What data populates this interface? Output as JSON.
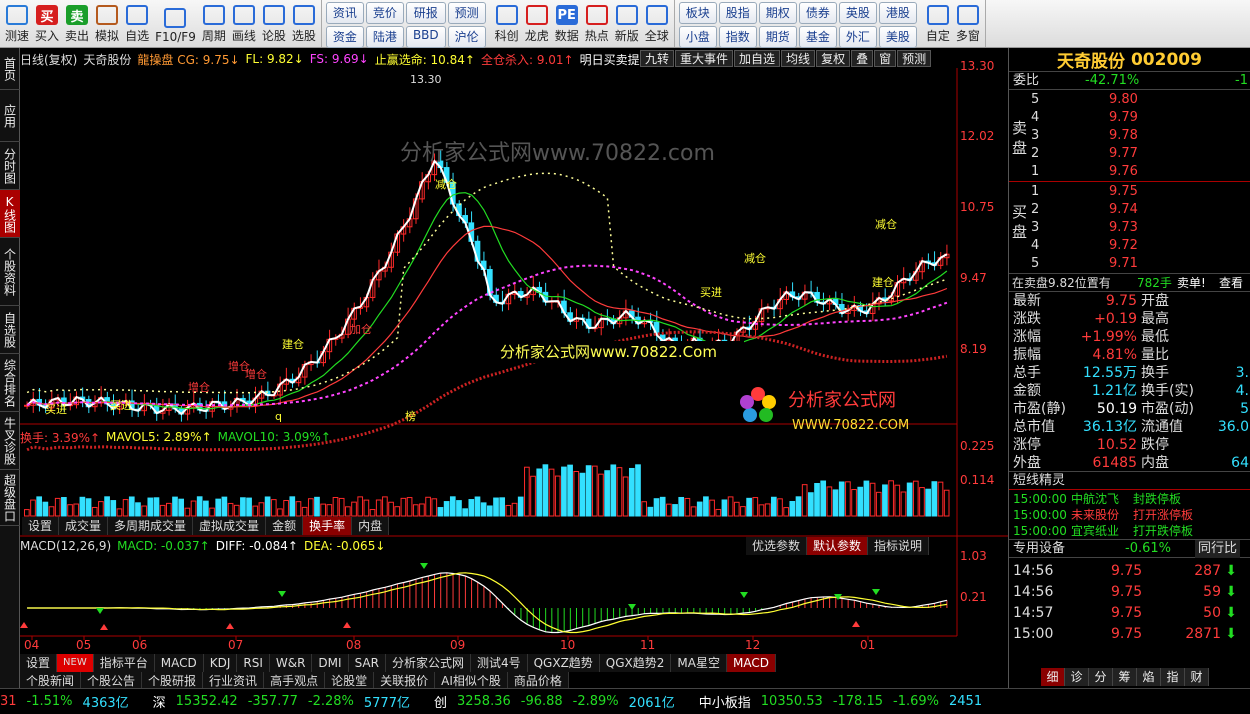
{
  "toolbar": {
    "buttons": [
      {
        "label": "测速",
        "icon": "speed-icon",
        "color": "#2a7bd8"
      },
      {
        "label": "买入",
        "icon": "buy-icon",
        "color": "#d61f1f",
        "glyph": "买"
      },
      {
        "label": "卖出",
        "icon": "sell-icon",
        "color": "#1a9e2a",
        "glyph": "卖"
      },
      {
        "label": "模拟",
        "icon": "hammer-icon",
        "color": "#b55a1e"
      },
      {
        "label": "自选",
        "icon": "star-folder-icon",
        "color": "#2a6bd8"
      },
      {
        "label": "F10/F9",
        "icon": "f10-icon",
        "color": "#2a6bd8"
      },
      {
        "label": "周期",
        "icon": "clock-icon",
        "color": "#2a6bd8"
      },
      {
        "label": "画线",
        "icon": "pen-icon",
        "color": "#2a6bd8"
      },
      {
        "label": "论股",
        "icon": "forum-icon",
        "color": "#2a6bd8"
      },
      {
        "label": "选股",
        "icon": "magnify-icon",
        "color": "#2a6bd8"
      }
    ],
    "group1": [
      "资讯",
      "资金",
      "竞价",
      "陆港",
      "研报",
      "BBD",
      "预测",
      "沪伦"
    ],
    "buttons2": [
      {
        "label": "科创",
        "icon": "tech-icon",
        "color": "#2a6bd8"
      },
      {
        "label": "龙虎",
        "icon": "dragon-icon",
        "color": "#d61f1f"
      },
      {
        "label": "数据",
        "icon": "pe-icon",
        "color": "#2a6bd8",
        "glyph": "PE"
      },
      {
        "label": "热点",
        "icon": "hot-icon",
        "color": "#d61f1f"
      },
      {
        "label": "新版",
        "icon": "new-icon",
        "color": "#2a6bd8"
      },
      {
        "label": "全球",
        "icon": "globe-icon",
        "color": "#2a6bd8"
      }
    ],
    "group2": [
      "板块",
      "小盘",
      "股指",
      "指数",
      "期权",
      "期货",
      "债券",
      "基金",
      "英股",
      "外汇",
      "港股",
      "美股"
    ],
    "buttons3": [
      {
        "label": "自定",
        "icon": "custom-icon",
        "color": "#2a6bd8"
      },
      {
        "label": "多窗",
        "icon": "multiwindow-icon",
        "color": "#2a6bd8"
      }
    ]
  },
  "sidebar": [
    "首页",
    "应用",
    "分时图",
    "K线图",
    "个股资料",
    "自选股",
    "综合排名",
    "牛叉诊股",
    "超级盘口"
  ],
  "chart": {
    "info": [
      "日线(复权)",
      "天奇股份",
      "龍操盘 CG: 9.75↓",
      "FL: 9.82↓",
      "FS: 9.69↓",
      "止赢选命: 10.84↑",
      "全仓杀入: 9.01↑",
      "明日买卖提示: 9."
    ],
    "tools": [
      "九转",
      "重大事件",
      "加自选",
      "均线",
      "复权",
      "叠",
      "窗",
      "预测"
    ],
    "price_labels": [
      "13.30",
      "12.02",
      "10.75",
      "9.47",
      "8.19"
    ],
    "high_mark": "13.30",
    "annotations": [
      "减仓",
      "减仓",
      "减仓",
      "建仓",
      "建仓",
      "加仓",
      "增仓",
      "增仓",
      "增仓",
      "买进",
      "买进",
      "买进",
      "q",
      "榜"
    ],
    "watermark1": "分析家公式网www.70822.com",
    "watermark2": "分析家公式网www.70822.Com",
    "logo_text": "分析家公式网",
    "logo_url": "WWW.70822.COM",
    "vol_info": [
      "换手: 3.39%↑",
      "MAVOL5: 2.89%↑",
      "MAVOL10: 3.09%↑"
    ],
    "vol_labels": [
      "0.225",
      "0.114"
    ],
    "vol_tabs": [
      "设置",
      "成交量",
      "多周期成交量",
      "虚拟成交量",
      "金额",
      "换手率",
      "内盘"
    ],
    "macd_info": [
      "MACD(12,26,9)",
      "MACD: -0.037↑",
      "DIFF: -0.084↑",
      "DEA: -0.065↓"
    ],
    "macd_buttons": [
      "优选参数",
      "默认参数",
      "指标说明"
    ],
    "macd_labels": [
      "1.03",
      "0.21"
    ],
    "months": [
      "04",
      "05",
      "06",
      "07",
      "08",
      "09",
      "10",
      "11",
      "12",
      "01"
    ],
    "bottom_tabs": [
      "设置",
      "NEW",
      "指标平台",
      "MACD",
      "KDJ",
      "RSI",
      "W&R",
      "DMI",
      "SAR",
      "分析家公式网",
      "测试4号",
      "QGXZ趋势",
      "QGX趋势2",
      "MA星空",
      "MACD"
    ],
    "news_tabs": [
      "个股新闻",
      "个股公告",
      "个股研报",
      "行业资讯",
      "高手观点",
      "论股堂",
      "关联报价",
      "AI相似个股",
      "商品价格"
    ]
  },
  "panel": {
    "name": "天奇股份",
    "code": "002009",
    "weibi_label": "委比",
    "weibi_value": "-42.71%",
    "weibi_extra": "-1",
    "sell_label": "卖盘",
    "buy_label": "买盘",
    "sells": [
      {
        "n": "5",
        "p": "9.80"
      },
      {
        "n": "4",
        "p": "9.79"
      },
      {
        "n": "3",
        "p": "9.78"
      },
      {
        "n": "2",
        "p": "9.77"
      },
      {
        "n": "1",
        "p": "9.76"
      }
    ],
    "buys": [
      {
        "n": "1",
        "p": "9.75"
      },
      {
        "n": "2",
        "p": "9.74"
      },
      {
        "n": "3",
        "p": "9.73"
      },
      {
        "n": "4",
        "p": "9.72"
      },
      {
        "n": "5",
        "p": "9.71"
      }
    ],
    "sell_notice": "在卖盘9.82位置有",
    "sell_notice_qty": "782手",
    "sell_notice_tag": "卖单!",
    "sell_notice_more": "查看",
    "stats": [
      {
        "l": "最新",
        "v": "9.75",
        "c": "red",
        "l2": "开盘",
        "v2": ""
      },
      {
        "l": "涨跌",
        "v": "+0.19",
        "c": "red",
        "l2": "最高",
        "v2": ""
      },
      {
        "l": "涨幅",
        "v": "+1.99%",
        "c": "red",
        "l2": "最低",
        "v2": ""
      },
      {
        "l": "振幅",
        "v": "4.81%",
        "c": "red",
        "l2": "量比",
        "v2": ""
      },
      {
        "l": "总手",
        "v": "12.55万",
        "c": "cyan",
        "l2": "换手",
        "v2": "3."
      },
      {
        "l": "金额",
        "v": "1.21亿",
        "c": "cyan",
        "l2": "换手(实)",
        "v2": "4."
      },
      {
        "l": "市盈(静)",
        "v": "50.19",
        "c": "white",
        "l2": "市盈(动)",
        "v2": "5"
      },
      {
        "l": "总市值",
        "v": "36.13亿",
        "c": "cyan",
        "l2": "流通值",
        "v2": "36.0"
      },
      {
        "l": "涨停",
        "v": "10.52",
        "c": "red",
        "l2": "跌停",
        "v2": ""
      },
      {
        "l": "外盘",
        "v": "61485",
        "c": "red",
        "l2": "内盘",
        "v2": "64"
      }
    ],
    "elf_title": "短线精灵",
    "elf": [
      {
        "t": "15:00:00",
        "n": "中航沈飞",
        "e": "封跌停板",
        "c": "green"
      },
      {
        "t": "15:00:00",
        "n": "未来股份",
        "e": "打开涨停板",
        "c": "red"
      },
      {
        "t": "15:00:00",
        "n": "宜宾纸业",
        "e": "打开跌停板",
        "c": "green"
      }
    ],
    "sector_label": "专用设备",
    "sector_change": "-0.61%",
    "sector_btn": "同行比",
    "ticks": [
      {
        "t": "14:56",
        "p": "9.75",
        "q": "287",
        "d": "down"
      },
      {
        "t": "14:56",
        "p": "9.75",
        "q": "59",
        "d": "down"
      },
      {
        "t": "14:57",
        "p": "9.75",
        "q": "50",
        "d": "down"
      },
      {
        "t": "15:00",
        "p": "9.75",
        "q": "2871",
        "d": "down"
      }
    ],
    "tabs": [
      "细",
      "诊",
      "分",
      "筹",
      "焰",
      "指",
      "财"
    ]
  },
  "status": {
    "items": [
      {
        "text": "31",
        "c": "red"
      },
      {
        "text": "-1.51%",
        "c": "green"
      },
      {
        "text": "4363亿",
        "c": "cyan"
      },
      {
        "text": "深",
        "c": "white"
      },
      {
        "text": "15352.42",
        "c": "green"
      },
      {
        "text": "-357.77",
        "c": "green"
      },
      {
        "text": "-2.28%",
        "c": "green"
      },
      {
        "text": "5777亿",
        "c": "cyan"
      },
      {
        "text": "创",
        "c": "white"
      },
      {
        "text": "3258.36",
        "c": "green"
      },
      {
        "text": "-96.88",
        "c": "green"
      },
      {
        "text": "-2.89%",
        "c": "green"
      },
      {
        "text": "2061亿",
        "c": "cyan"
      },
      {
        "text": "中小板指",
        "c": "white"
      },
      {
        "text": "10350.53",
        "c": "green"
      },
      {
        "text": "-178.15",
        "c": "green"
      },
      {
        "text": "-1.69%",
        "c": "green"
      },
      {
        "text": "2451",
        "c": "cyan"
      }
    ]
  }
}
